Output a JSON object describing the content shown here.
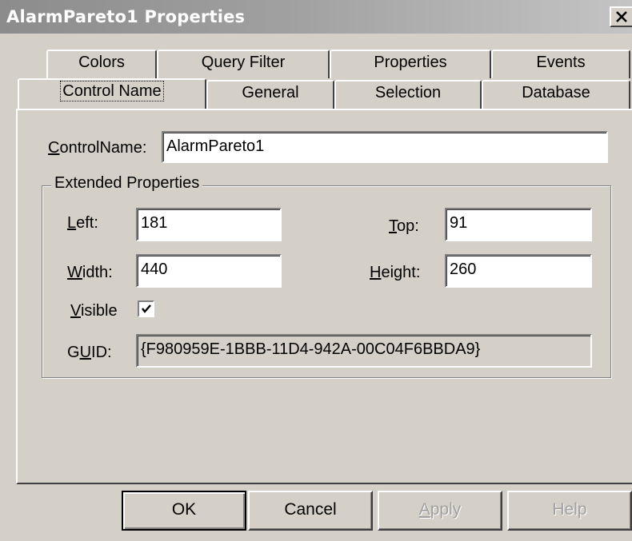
{
  "window": {
    "title": "AlarmPareto1 Properties",
    "close_label": "×"
  },
  "tabs_back": [
    {
      "label": "Colors"
    },
    {
      "label": "Query Filter"
    },
    {
      "label": "Properties"
    },
    {
      "label": "Events"
    }
  ],
  "tabs_front": [
    {
      "label": "Control Name"
    },
    {
      "label": "General"
    },
    {
      "label": "Selection"
    },
    {
      "label": "Database"
    }
  ],
  "form": {
    "control_name": {
      "label": "ControlName:",
      "value": "AlarmPareto1"
    },
    "group_title": "Extended Properties",
    "left": {
      "label": "Left:",
      "value": "181"
    },
    "top": {
      "label": "Top:",
      "value": "91"
    },
    "width": {
      "label": "Width:",
      "value": "440"
    },
    "height": {
      "label": "Height:",
      "value": "260"
    },
    "visible": {
      "label": "Visible",
      "checked": true
    },
    "guid": {
      "label": "GUID:",
      "value": "{F980959E-1BBB-11D4-942A-00C04F6BBDA9}"
    }
  },
  "buttons": {
    "ok": "OK",
    "cancel": "Cancel",
    "apply": "Apply",
    "help": "Help"
  }
}
